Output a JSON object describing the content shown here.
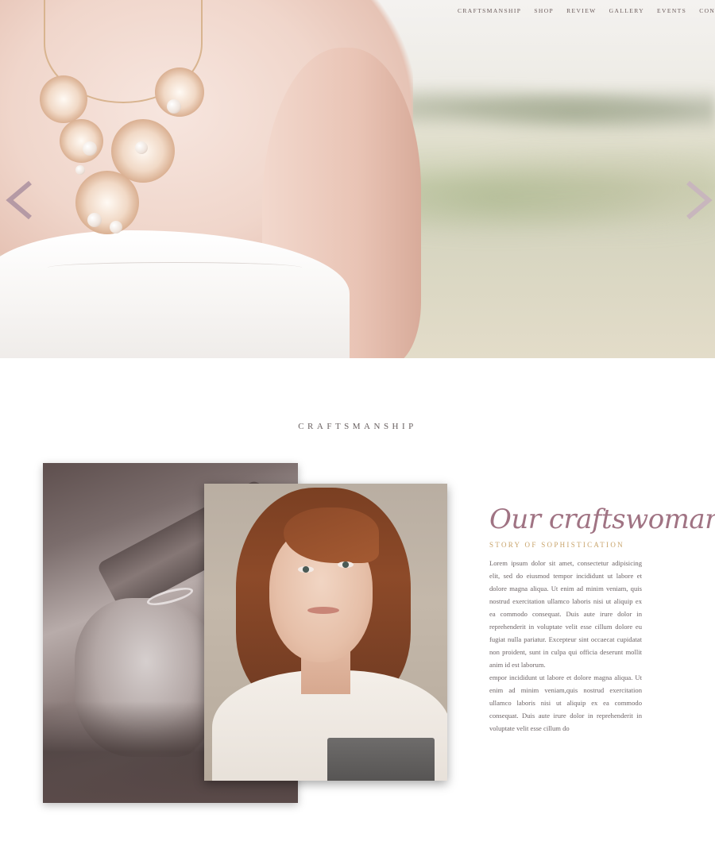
{
  "nav": {
    "items": [
      "CRAFTSMANSHIP",
      "SHOP",
      "REVIEW",
      "GALLERY",
      "EVENTS",
      "CONTACT"
    ]
  },
  "hero": {
    "prev_icon": "chevron-left-icon",
    "next_icon": "chevron-right-icon"
  },
  "section": {
    "heading": "CRAFTSMANSHIP",
    "title": "Our craftswoman",
    "subtitle": "STORY OF SOPHISTICATION",
    "paragraph_1": "Lorem ipsum dolor sit amet, consectetur adipisicing elit, sed do eiusmod tempor incididunt ut labore et dolore magna aliqua. Ut enim ad minim veniam, quis nostrud exercitation ullamco laboris nisi ut aliquip ex ea commodo consequat. Duis aute irure dolor in reprehenderit in voluptate velit esse cillum dolore eu fugiat nulla pariatur. Excepteur sint occaecat cupidatat non proident, sunt in culpa qui officia deserunt mollit anim id est laborum.",
    "paragraph_2": "empor incididunt ut labore et dolore magna aliqua. Ut enim ad minim veniam,quis nostrud exercitation ullamco laboris nisi ut aliquip ex ea commodo consequat. Duis aute irure dolor in reprehenderit in voluptate velit esse cillum do"
  },
  "colors": {
    "accent_script": "#a07383",
    "accent_gold": "#c8a36a",
    "arrow": "#b59aa5"
  }
}
